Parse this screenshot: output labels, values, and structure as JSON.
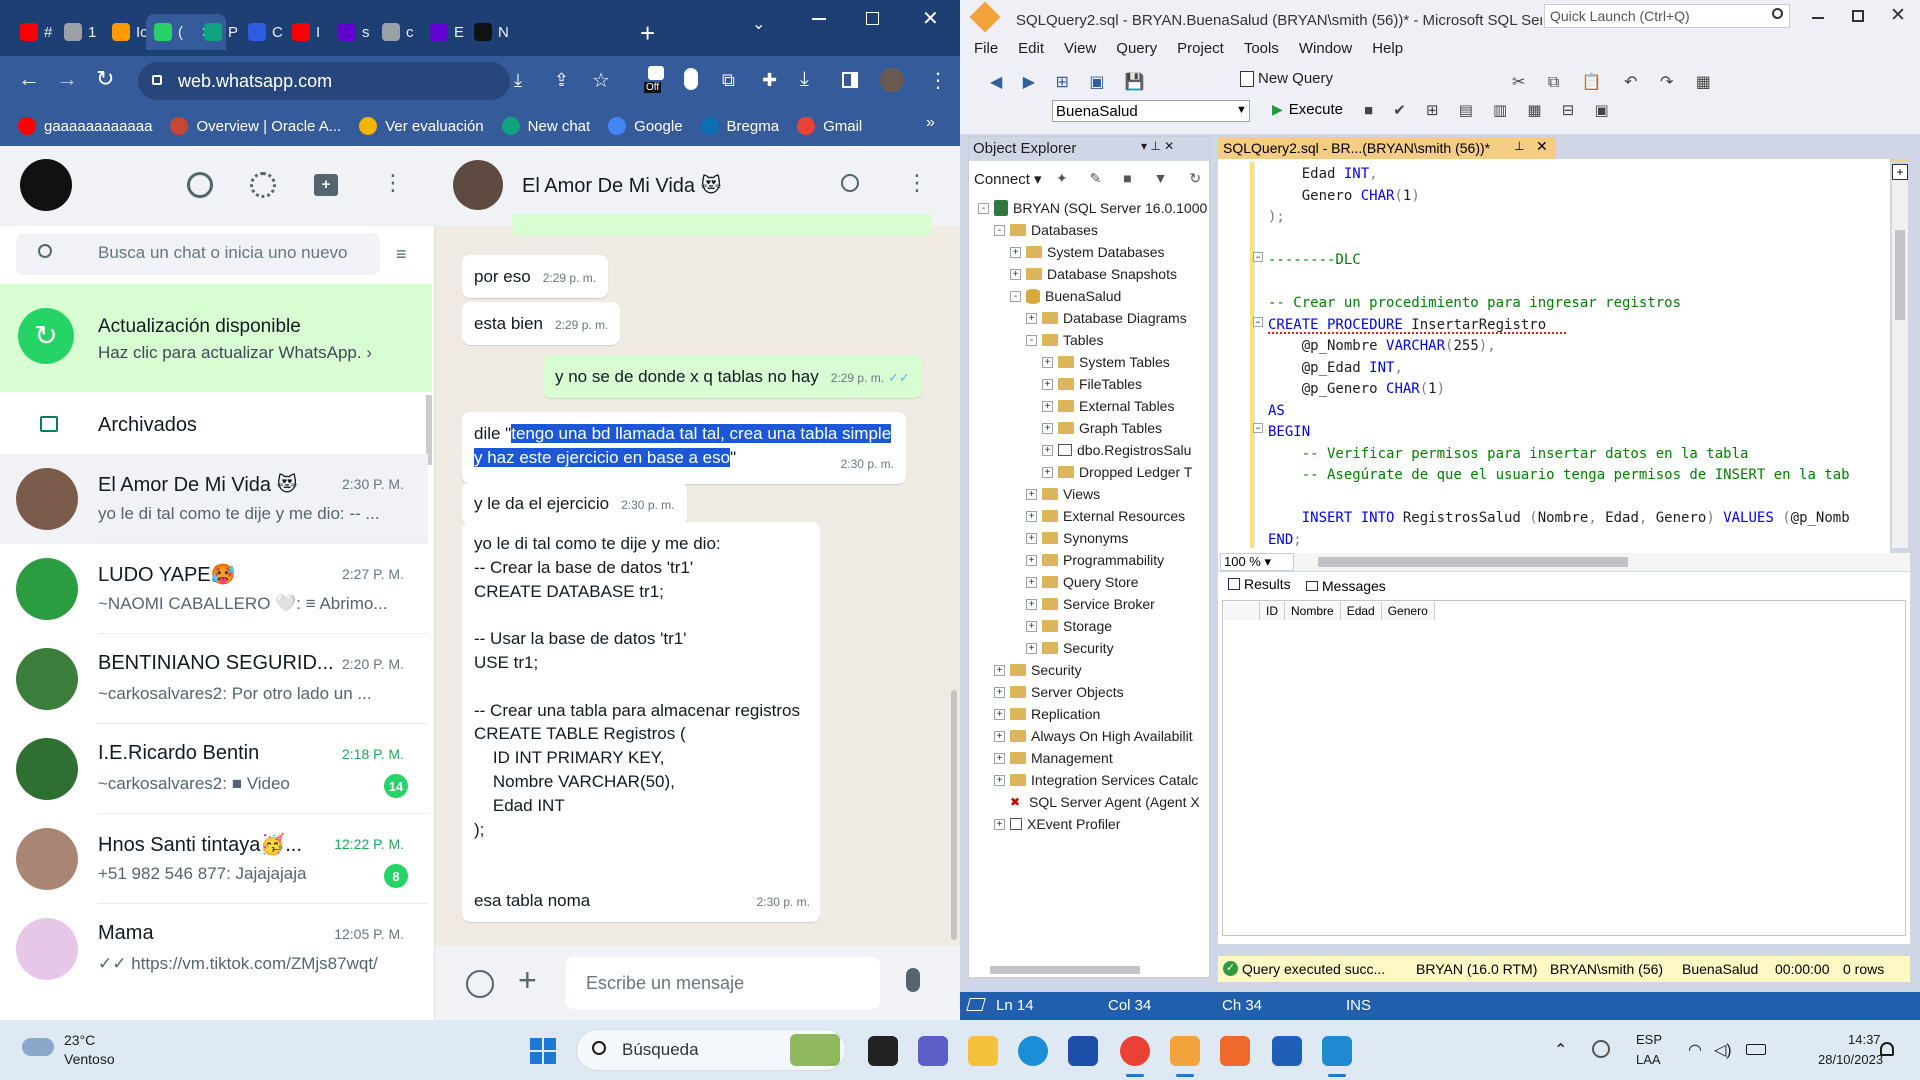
{
  "chrome": {
    "tabs": [
      {
        "label": "#",
        "icon": "youtube-icon",
        "color": "#ff0000"
      },
      {
        "label": "1",
        "icon": "globe-icon",
        "color": "#9aa0a6"
      },
      {
        "label": "Ic",
        "icon": "aws-icon",
        "color": "#ff9900"
      },
      {
        "label": "(",
        "icon": "whatsapp-icon",
        "color": "#25d366"
      },
      {
        "label": "P",
        "icon": "openai-icon",
        "color": "#10a37f"
      },
      {
        "label": "C",
        "icon": "bing-icon",
        "color": "#2f5de0"
      },
      {
        "label": "I",
        "icon": "youtube-icon",
        "color": "#ff0000"
      },
      {
        "label": "s",
        "icon": "yahoo-icon",
        "color": "#6001d2"
      },
      {
        "label": "c",
        "icon": "globe-icon",
        "color": "#9aa0a6"
      },
      {
        "label": "E",
        "icon": "yahoo-icon",
        "color": "#6001d2"
      },
      {
        "label": "N",
        "icon": "notion-icon",
        "color": "#111111"
      }
    ],
    "url": "web.whatsapp.com",
    "bookmarks": [
      {
        "label": "gaaaaaaaaaaaa",
        "icon": "youtube-icon",
        "color": "#ff0000"
      },
      {
        "label": "Overview | Oracle A...",
        "icon": "oracle-icon",
        "color": "#c74634"
      },
      {
        "label": "Ver evaluación",
        "icon": "chart-icon",
        "color": "#f4b400"
      },
      {
        "label": "New chat",
        "icon": "openai-icon",
        "color": "#10a37f"
      },
      {
        "label": "Google",
        "icon": "google-icon",
        "color": "#4285f4"
      },
      {
        "label": "Bregma",
        "icon": "bregma-icon",
        "color": "#0b6fb5"
      },
      {
        "label": "Gmail",
        "icon": "gmail-icon",
        "color": "#ea4335"
      }
    ],
    "ext_badge": "Off"
  },
  "whatsapp": {
    "search_placeholder": "Busca un chat o inicia uno nuevo",
    "update": {
      "title": "Actualización disponible",
      "subtitle": "Haz clic para actualizar WhatsApp. ›"
    },
    "archived": "Archivados",
    "chats": [
      {
        "name": "El Amor De Mi Vida 😻",
        "time": "2:30 P. M.",
        "preview": "yo le di tal como te dije y me dio: -- ...",
        "color": "#7a5a4a"
      },
      {
        "name": "LUDO YAPE🥵",
        "time": "2:27 P. M.",
        "preview": "~NAOMI CABALLERO 🤍: ≡ Abrimo...",
        "color": "#2b9c3f"
      },
      {
        "name": "BENTINIANO SEGURID...",
        "time": "2:20 P. M.",
        "preview": "~carkosalvares2: Por otro lado un ...",
        "color": "#3b7d3b"
      },
      {
        "name": "I.E.Ricardo Bentin",
        "time": "2:18 P. M.",
        "preview": "~carkosalvares2: ■ Video",
        "badge": "14",
        "color": "#2e6f32"
      },
      {
        "name": "Hnos Santi tintaya🥳...",
        "time": "12:22 P. M.",
        "preview": "+51 982 546 877: Jajajajaja",
        "badge": "8",
        "color": "#a98674"
      },
      {
        "name": "Mama",
        "time": "12:05 P. M.",
        "preview": "✓✓ https://vm.tiktok.com/ZMjs87wqt/",
        "color": "#e6c7e8"
      }
    ],
    "contact": "El Amor De Mi Vida 😻",
    "messages": [
      {
        "text": "por eso",
        "time": "2:29 p. m."
      },
      {
        "text": "esta bien",
        "time": "2:29 p. m."
      },
      {
        "text": "y no se de donde x q tablas no hay",
        "time": "2:29 p. m."
      },
      {
        "prefix": "dile \"",
        "highlight": "tengo una bd llamada tal tal, crea una tabla simple y haz este ejercicio en base a eso",
        "suffix": "\"",
        "time": "2:30 p. m."
      },
      {
        "text": "y le da el ejercicio",
        "time": "2:30 p. m."
      },
      {
        "lines": [
          "yo le di tal como te dije y me dio:",
          "-- Crear la base de datos 'tr1'",
          "CREATE DATABASE tr1;",
          "",
          "-- Usar la base de datos 'tr1'",
          "USE tr1;",
          "",
          "-- Crear una tabla para almacenar registros",
          "CREATE TABLE Registros (",
          "    ID INT PRIMARY KEY,",
          "    Nombre VARCHAR(50),",
          "    Edad INT",
          ");",
          "",
          "",
          "esa tabla noma"
        ],
        "time": "2:30 p. m."
      }
    ],
    "composer_placeholder": "Escribe un mensaje"
  },
  "ssms": {
    "title": "SQLQuery2.sql - BRYAN.BuenaSalud (BRYAN\\smith (56))* - Microsoft SQL Serv...",
    "quick_launch": "Quick Launch (Ctrl+Q)",
    "menu": [
      "File",
      "Edit",
      "View",
      "Query",
      "Project",
      "Tools",
      "Window",
      "Help"
    ],
    "new_query": "New Query",
    "database": "BuenaSalud",
    "execute": "Execute",
    "object_explorer": "Object Explorer",
    "connect": "Connect",
    "tree": [
      {
        "label": "BRYAN (SQL Server 16.0.1000",
        "level": 0,
        "state": "-",
        "kind": "server"
      },
      {
        "label": "Databases",
        "level": 1,
        "state": "-",
        "kind": "folder"
      },
      {
        "label": "System Databases",
        "level": 2,
        "state": "+",
        "kind": "folder"
      },
      {
        "label": "Database Snapshots",
        "level": 2,
        "state": "+",
        "kind": "folder"
      },
      {
        "label": "BuenaSalud",
        "level": 2,
        "state": "-",
        "kind": "db"
      },
      {
        "label": "Database Diagrams",
        "level": 3,
        "state": "+",
        "kind": "folder"
      },
      {
        "label": "Tables",
        "level": 3,
        "state": "-",
        "kind": "folder"
      },
      {
        "label": "System Tables",
        "level": 4,
        "state": "+",
        "kind": "folder"
      },
      {
        "label": "FileTables",
        "level": 4,
        "state": "+",
        "kind": "folder"
      },
      {
        "label": "External Tables",
        "level": 4,
        "state": "+",
        "kind": "folder"
      },
      {
        "label": "Graph Tables",
        "level": 4,
        "state": "+",
        "kind": "folder"
      },
      {
        "label": "dbo.RegistrosSalu",
        "level": 4,
        "state": "+",
        "kind": "table"
      },
      {
        "label": "Dropped Ledger T",
        "level": 4,
        "state": "+",
        "kind": "folder"
      },
      {
        "label": "Views",
        "level": 3,
        "state": "+",
        "kind": "folder"
      },
      {
        "label": "External Resources",
        "level": 3,
        "state": "+",
        "kind": "folder"
      },
      {
        "label": "Synonyms",
        "level": 3,
        "state": "+",
        "kind": "folder"
      },
      {
        "label": "Programmability",
        "level": 3,
        "state": "+",
        "kind": "folder"
      },
      {
        "label": "Query Store",
        "level": 3,
        "state": "+",
        "kind": "folder"
      },
      {
        "label": "Service Broker",
        "level": 3,
        "state": "+",
        "kind": "folder"
      },
      {
        "label": "Storage",
        "level": 3,
        "state": "+",
        "kind": "folder"
      },
      {
        "label": "Security",
        "level": 3,
        "state": "+",
        "kind": "folder"
      },
      {
        "label": "Security",
        "level": 1,
        "state": "+",
        "kind": "folder"
      },
      {
        "label": "Server Objects",
        "level": 1,
        "state": "+",
        "kind": "folder"
      },
      {
        "label": "Replication",
        "level": 1,
        "state": "+",
        "kind": "folder"
      },
      {
        "label": "Always On High Availabilit",
        "level": 1,
        "state": "+",
        "kind": "folder"
      },
      {
        "label": "Management",
        "level": 1,
        "state": "+",
        "kind": "folder"
      },
      {
        "label": "Integration Services Catalc",
        "level": 1,
        "state": "+",
        "kind": "folder"
      },
      {
        "label": "SQL Server Agent (Agent X",
        "level": 1,
        "state": "",
        "kind": "agent"
      },
      {
        "label": "XEvent Profiler",
        "level": 1,
        "state": "+",
        "kind": "xevent"
      }
    ],
    "editor_tab": "SQLQuery2.sql - BR...(BRYAN\\smith (56))*",
    "code": [
      [
        {
          "t": "    Edad ",
          "c": "n"
        },
        {
          "t": "INT",
          "c": "k"
        },
        {
          "t": ",",
          "c": "g"
        }
      ],
      [
        {
          "t": "    Genero ",
          "c": "n"
        },
        {
          "t": "CHAR",
          "c": "k"
        },
        {
          "t": "(",
          "c": "g"
        },
        {
          "t": "1",
          "c": "n"
        },
        {
          "t": ")",
          "c": "g"
        }
      ],
      [
        {
          "t": ");",
          "c": "g"
        }
      ],
      [
        {
          "t": "",
          "c": "n"
        }
      ],
      [
        {
          "t": "--------DLC",
          "c": "c"
        }
      ],
      [
        {
          "t": "",
          "c": "n"
        }
      ],
      [
        {
          "t": "-- Crear un procedimiento para ingresar registros",
          "c": "c"
        }
      ],
      [
        {
          "t": "CREATE PROCEDURE ",
          "c": "k"
        },
        {
          "t": "InsertarRegistro",
          "c": "n"
        }
      ],
      [
        {
          "t": "    @p_Nombre ",
          "c": "n"
        },
        {
          "t": "VARCHAR",
          "c": "k"
        },
        {
          "t": "(",
          "c": "g"
        },
        {
          "t": "255",
          "c": "n"
        },
        {
          "t": "),",
          "c": "g"
        }
      ],
      [
        {
          "t": "    @p_Edad ",
          "c": "n"
        },
        {
          "t": "INT",
          "c": "k"
        },
        {
          "t": ",",
          "c": "g"
        }
      ],
      [
        {
          "t": "    @p_Genero ",
          "c": "n"
        },
        {
          "t": "CHAR",
          "c": "k"
        },
        {
          "t": "(",
          "c": "g"
        },
        {
          "t": "1",
          "c": "n"
        },
        {
          "t": ")",
          "c": "g"
        }
      ],
      [
        {
          "t": "AS",
          "c": "k"
        }
      ],
      [
        {
          "t": "BEGIN",
          "c": "k"
        }
      ],
      [
        {
          "t": "    -- Verificar permisos para insertar datos en la tabla",
          "c": "c"
        }
      ],
      [
        {
          "t": "    -- Asegúrate de que el usuario tenga permisos de INSERT en la tab",
          "c": "c"
        }
      ],
      [
        {
          "t": "",
          "c": "n"
        }
      ],
      [
        {
          "t": "    INSERT INTO ",
          "c": "k"
        },
        {
          "t": "RegistrosSalud ",
          "c": "n"
        },
        {
          "t": "(",
          "c": "g"
        },
        {
          "t": "Nombre",
          "c": "n"
        },
        {
          "t": ", ",
          "c": "g"
        },
        {
          "t": "Edad",
          "c": "n"
        },
        {
          "t": ", ",
          "c": "g"
        },
        {
          "t": "Genero",
          "c": "n"
        },
        {
          "t": ") ",
          "c": "g"
        },
        {
          "t": "VALUES ",
          "c": "k"
        },
        {
          "t": "(",
          "c": "g"
        },
        {
          "t": "@p_Nomb",
          "c": "n"
        }
      ],
      [
        {
          "t": "END",
          "c": "k"
        },
        {
          "t": ";",
          "c": "g"
        }
      ]
    ],
    "zoom": "100 %",
    "results_tab": "Results",
    "messages_tab": "Messages",
    "columns": [
      "ID",
      "Nombre",
      "Edad",
      "Genero"
    ],
    "query_status": "Query executed succ...",
    "server": "BRYAN (16.0 RTM)",
    "user": "BRYAN\\smith (56)",
    "db": "BuenaSalud",
    "elapsed": "00:00:00",
    "rows": "0 rows",
    "status": {
      "ln": "Ln 14",
      "col": "Col 34",
      "ch": "Ch 34",
      "mode": "INS"
    }
  },
  "taskbar": {
    "temp": "23°C",
    "weather": "Ventoso",
    "search": "Búsqueda",
    "lang1": "ESP",
    "lang2": "LAA",
    "time": "14:37",
    "date": "28/10/2023"
  }
}
